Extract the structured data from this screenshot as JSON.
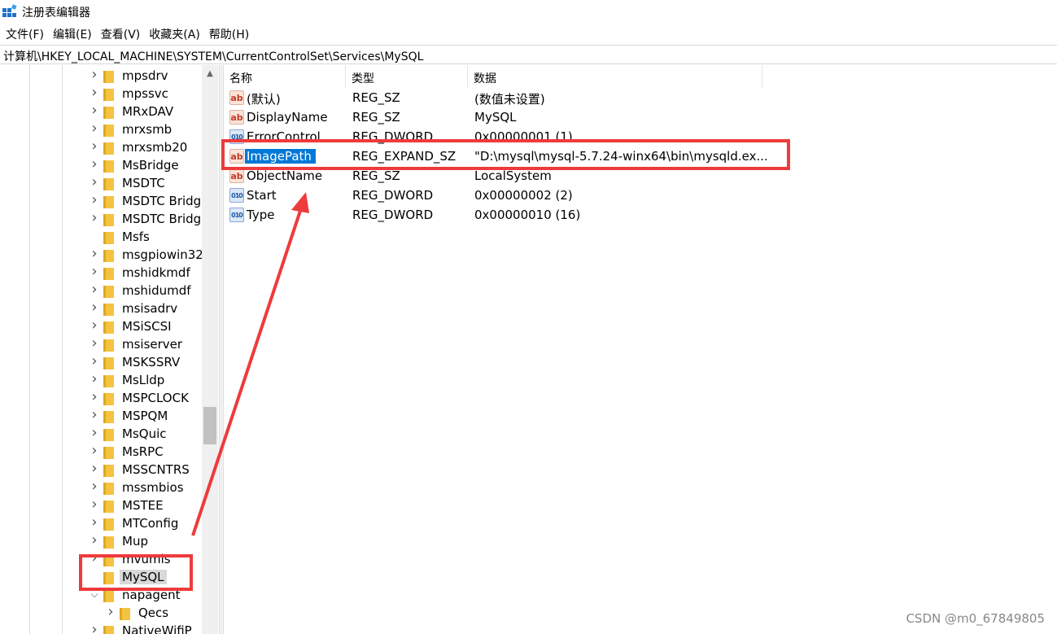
{
  "window": {
    "title": "注册表编辑器",
    "app_icon": "regedit-icon"
  },
  "menubar": [
    "文件(F)",
    "编辑(E)",
    "查看(V)",
    "收藏夹(A)",
    "帮助(H)"
  ],
  "address": "计算机\\HKEY_LOCAL_MACHINE\\SYSTEM\\CurrentControlSet\\Services\\MySQL",
  "tree": {
    "items": [
      {
        "label": "mpsdrv",
        "expandable": true
      },
      {
        "label": "mpssvc",
        "expandable": true
      },
      {
        "label": "MRxDAV",
        "expandable": true
      },
      {
        "label": "mrxsmb",
        "expandable": true
      },
      {
        "label": "mrxsmb20",
        "expandable": true
      },
      {
        "label": "MsBridge",
        "expandable": true
      },
      {
        "label": "MSDTC",
        "expandable": true
      },
      {
        "label": "MSDTC Bridg",
        "expandable": true
      },
      {
        "label": "MSDTC Bridg",
        "expandable": true
      },
      {
        "label": "Msfs",
        "expandable": false
      },
      {
        "label": "msgpiowin32",
        "expandable": true
      },
      {
        "label": "mshidkmdf",
        "expandable": true
      },
      {
        "label": "mshidumdf",
        "expandable": true
      },
      {
        "label": "msisadrv",
        "expandable": true
      },
      {
        "label": "MSiSCSI",
        "expandable": true
      },
      {
        "label": "msiserver",
        "expandable": true
      },
      {
        "label": "MSKSSRV",
        "expandable": true
      },
      {
        "label": "MsLldp",
        "expandable": true
      },
      {
        "label": "MSPCLOCK",
        "expandable": true
      },
      {
        "label": "MSPQM",
        "expandable": true
      },
      {
        "label": "MsQuic",
        "expandable": true
      },
      {
        "label": "MsRPC",
        "expandable": true
      },
      {
        "label": "MSSCNTRS",
        "expandable": true
      },
      {
        "label": "mssmbios",
        "expandable": true
      },
      {
        "label": "MSTEE",
        "expandable": true
      },
      {
        "label": "MTConfig",
        "expandable": true
      },
      {
        "label": "Mup",
        "expandable": true
      },
      {
        "label": "mvumis",
        "expandable": true
      },
      {
        "label": "MySQL",
        "expandable": false,
        "selected": true
      },
      {
        "label": "napagent",
        "expandable": true,
        "expanded": true
      },
      {
        "label": "Qecs",
        "expandable": true,
        "sub": true
      },
      {
        "label": "NativeWifiP",
        "expandable": true
      }
    ]
  },
  "columns": {
    "name": "名称",
    "type": "类型",
    "data": "数据"
  },
  "values": [
    {
      "name": "(默认)",
      "type": "REG_SZ",
      "data": "(数值未设置)",
      "icon": "string-value-icon",
      "icon_text": "ab"
    },
    {
      "name": "DisplayName",
      "type": "REG_SZ",
      "data": "MySQL",
      "icon": "string-value-icon",
      "icon_text": "ab"
    },
    {
      "name": "ErrorControl",
      "type": "REG_DWORD",
      "data": "0x00000001 (1)",
      "icon": "dword-value-icon",
      "icon_text": "010"
    },
    {
      "name": "ImagePath",
      "type": "REG_EXPAND_SZ",
      "data": "\"D:\\mysql\\mysql-5.7.24-winx64\\bin\\mysqld.ex...",
      "icon": "string-value-icon",
      "icon_text": "ab",
      "selected": true
    },
    {
      "name": "ObjectName",
      "type": "REG_SZ",
      "data": "LocalSystem",
      "icon": "string-value-icon",
      "icon_text": "ab"
    },
    {
      "name": "Start",
      "type": "REG_DWORD",
      "data": "0x00000002 (2)",
      "icon": "dword-value-icon",
      "icon_text": "010"
    },
    {
      "name": "Type",
      "type": "REG_DWORD",
      "data": "0x00000010 (16)",
      "icon": "dword-value-icon",
      "icon_text": "010"
    }
  ],
  "watermark": "CSDN @m0_67849805",
  "colors": {
    "annotation": "#ee3b3b",
    "selection": "#0078d7",
    "folder": "#f5c342"
  }
}
